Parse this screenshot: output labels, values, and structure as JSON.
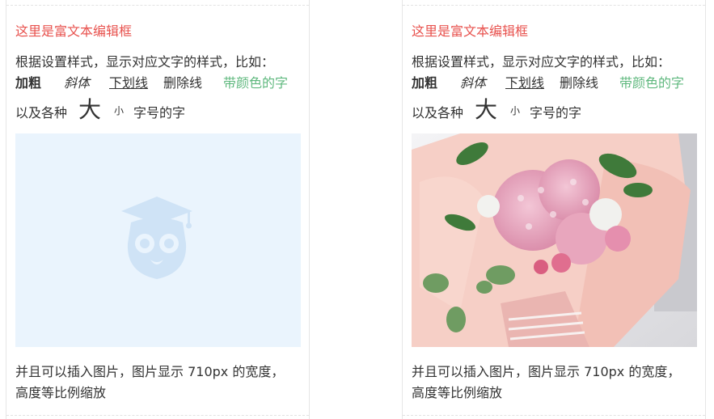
{
  "panels": [
    {
      "title": "这里是富文本编辑框",
      "intro": "根据设置样式，显示对应文字的样式，比如：",
      "styles": {
        "bold": "加粗",
        "italic": "斜体",
        "underline": "下划线",
        "strike": "删除线",
        "colored": "带颜色的字"
      },
      "size_line": {
        "prefix": "以及各种",
        "big": "大",
        "small": "小",
        "suffix": "字号的字"
      },
      "image_state": "placeholder",
      "placeholder_icon": "owl-graduation-cap-icon",
      "paragraph": [
        "并且可以插入图片，图片显示 710px 的宽度，",
        "高度等比例缩放"
      ]
    },
    {
      "title": "这里是富文本编辑框",
      "intro": "根据设置样式，显示对应文字的样式，比如：",
      "styles": {
        "bold": "加粗",
        "italic": "斜体",
        "underline": "下划线",
        "strike": "删除线",
        "colored": "带颜色的字"
      },
      "size_line": {
        "prefix": "以及各种",
        "big": "大",
        "small": "小",
        "suffix": "字号的字"
      },
      "image_state": "photo",
      "photo_subject": "pink-hydrangea-bouquet",
      "paragraph": [
        "并且可以插入图片，图片显示 710px 的宽度，",
        "高度等比例缩放"
      ]
    }
  ],
  "colors": {
    "title_red": "#e8524e",
    "accent_green": "#5fb87e",
    "placeholder_bg": "#eaf4fd",
    "text": "#333333"
  }
}
